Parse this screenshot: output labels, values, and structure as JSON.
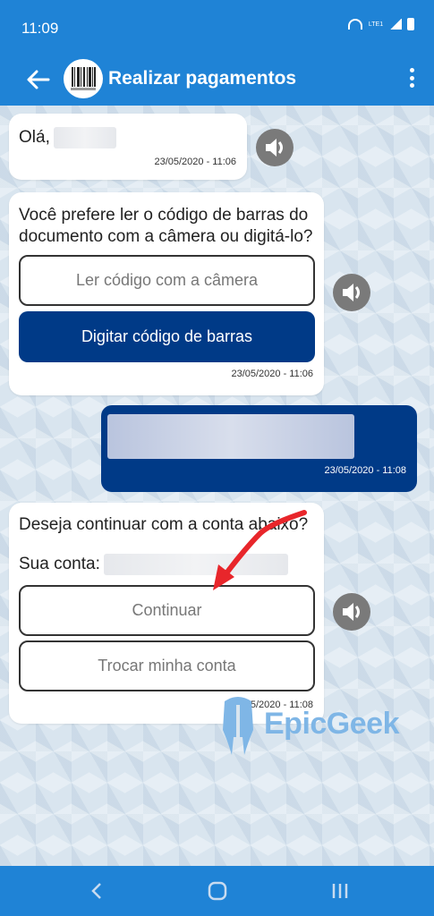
{
  "status_bar": {
    "time": "11:09",
    "network": "LTE1"
  },
  "app_bar": {
    "title": "Realizar pagamentos"
  },
  "messages": {
    "greeting": {
      "text": "Olá,",
      "time": "23/05/2020 - 11:06"
    },
    "choice": {
      "text": "Você prefere ler o código de barras do documento com a câmera ou digitá-lo?",
      "option_camera": "Ler código com a câmera",
      "option_type": "Digitar código de barras",
      "time": "23/05/2020 - 11:06"
    },
    "user_reply": {
      "time": "23/05/2020 - 11:08"
    },
    "confirm": {
      "text": "Deseja continuar com a conta abaixo?",
      "account_label": "Sua conta:",
      "option_continue": "Continuar",
      "option_change": "Trocar minha conta",
      "time": "23/05/2020 - 11:08"
    }
  },
  "watermark": {
    "text": "EpicGeek"
  },
  "colors": {
    "primary": "#1f83d6",
    "dark_button": "#003a87",
    "annotation_arrow": "#e8262b"
  }
}
